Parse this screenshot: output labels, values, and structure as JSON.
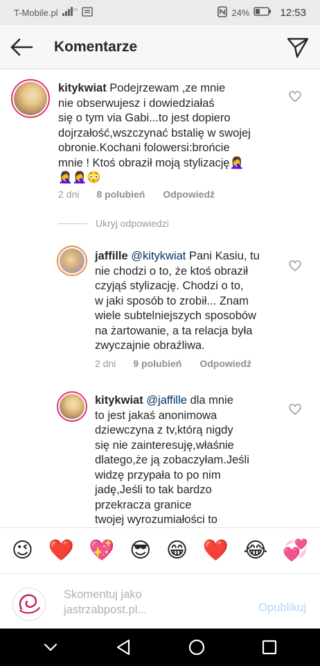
{
  "status_bar": {
    "carrier": "T-Mobile.pl",
    "battery": "24%",
    "time": "12:53"
  },
  "header": {
    "title": "Komentarze"
  },
  "comments": [
    {
      "username": "kitykwiat",
      "text": "Podejrzewam ,ze mnie\nnie obserwujesz i dowiedziałaś\nsię o tym via Gabi...to jest dopiero\ndojrzałość,wszczynać bstalię w swojej\nobronie.Kochani folowersi:brońcie\nmnie !  Ktoś obraził moją stylizację🤦‍♀️\n🤦‍♀️🤦‍♀️😳",
      "time": "2 dni",
      "likes": "8 polubień",
      "reply": "Odpowiedź"
    },
    {
      "username": "jaffille",
      "mention": "@kitykwiat",
      "text": " Pani Kasiu, tu\nnie chodzi o to, że ktoś obraził\nczyjąś stylizację. Chodzi o to,\nw jaki sposób to zrobił... Znam\nwiele subtelniejszych sposobów\nna żartowanie, a ta relacja była\nzwyczajnie obraźliwa.",
      "time": "2 dni",
      "likes": "9 polubień",
      "reply": "Odpowiedź"
    },
    {
      "username": "kitykwiat",
      "mention": "@jaffille",
      "text": " dla mnie\nto jest jakaś anonimowa\ndziewczyna z tv,którą nigdy\nsię nie zainteresuję,właśnie\ndlatego,że ją zobaczyłam.Jeśli\nwidzę przypała to po nim\njadę,Jeśli to tak bardzo\nprzekracza granice\ntwojej wyrozumiałości to\n                    Wybacz"
    }
  ],
  "hide_replies": "Ukryj odpowiedzi",
  "emojis": [
    "😉",
    "❤️",
    "💖",
    "😎",
    "😁",
    "❤️",
    "😂",
    "💞"
  ],
  "input": {
    "placeholder": "Skomentuj jako\njastrzabpost.pl...",
    "publish": "Opublikuj"
  }
}
